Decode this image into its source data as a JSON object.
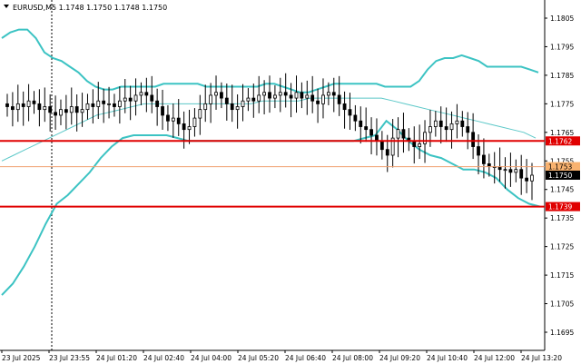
{
  "symbol_header": {
    "menu_icon": "triangle-down-icon",
    "text": "EURUSD,M5  1.1748 1.1750 1.1748 1.1750"
  },
  "chart_data": {
    "type": "candlestick",
    "symbol": "EURUSD,M5",
    "ohlc_last": {
      "open": 1.1748,
      "high": 1.175,
      "low": 1.1748,
      "close": 1.175
    },
    "ylim": [
      1.169,
      1.1805
    ],
    "yticks": [
      "1.1805",
      "1.1795",
      "1.1785",
      "1.1775",
      "1.1765",
      "1.1755",
      "1.1745",
      "1.1735",
      "1.1725",
      "1.1715",
      "1.1705",
      "1.1695"
    ],
    "xticks": [
      "23 Jul 2025",
      "23 Jul 23:55",
      "24 Jul 01:20",
      "24 Jul 02:40",
      "24 Jul 04:00",
      "24 Jul 05:20",
      "24 Jul 06:40",
      "24 Jul 08:00",
      "24 Jul 09:20",
      "24 Jul 10:40",
      "24 Jul 12:00",
      "24 Jul 13:20"
    ],
    "horizontal_levels": [
      {
        "price": 1.1762,
        "label": "1.1762",
        "color": "#e00000"
      },
      {
        "price": 1.1739,
        "label": "1.1739",
        "color": "#e00000"
      }
    ],
    "current_price_tags": [
      {
        "price": 1.1753,
        "label": "1.1753",
        "style": "orange"
      },
      {
        "price": 1.175,
        "label": "1.1750",
        "style": "black"
      }
    ],
    "ask_line_price": 1.1753,
    "closes": [
      1.1774,
      1.1773,
      1.1775,
      1.1774,
      1.1776,
      1.1775,
      1.1773,
      1.1774,
      1.1772,
      1.1771,
      1.1773,
      1.1772,
      1.1774,
      1.1772,
      1.1773,
      1.1775,
      1.1774,
      1.1776,
      1.1775,
      1.1775,
      1.1774,
      1.1776,
      1.1777,
      1.1776,
      1.1778,
      1.1779,
      1.1778,
      1.1776,
      1.1774,
      1.1771,
      1.1769,
      1.177,
      1.1768,
      1.1766,
      1.1767,
      1.177,
      1.1773,
      1.1775,
      1.1778,
      1.1779,
      1.1777,
      1.1775,
      1.1773,
      1.1774,
      1.1776,
      1.1777,
      1.1776,
      1.1778,
      1.1779,
      1.1777,
      1.1778,
      1.1779,
      1.1778,
      1.1777,
      1.1779,
      1.1777,
      1.1778,
      1.1776,
      1.1775,
      1.1778,
      1.1779,
      1.1778,
      1.1775,
      1.1773,
      1.1771,
      1.1769,
      1.1767,
      1.1766,
      1.1764,
      1.1762,
      1.1759,
      1.1757,
      1.1763,
      1.1766,
      1.1763,
      1.1762,
      1.176,
      1.1761,
      1.1765,
      1.1767,
      1.1769,
      1.1767,
      1.1766,
      1.1768,
      1.1769,
      1.1767,
      1.1765,
      1.176,
      1.1757,
      1.1754,
      1.1753,
      1.1753,
      1.1752,
      1.1752,
      1.1751,
      1.1752,
      1.1749,
      1.1748,
      1.175
    ],
    "bollinger": {
      "upper": [
        1.1798,
        1.18,
        1.1801,
        1.1801,
        1.1798,
        1.1793,
        1.1791,
        1.179,
        1.1788,
        1.1786,
        1.1783,
        1.1781,
        1.178,
        1.178,
        1.1781,
        1.1781,
        1.1781,
        1.1781,
        1.1781,
        1.1782,
        1.1782,
        1.1782,
        1.1782,
        1.1782,
        1.1781,
        1.1781,
        1.1781,
        1.1781,
        1.1781,
        1.1781,
        1.1781,
        1.1782,
        1.1782,
        1.1781,
        1.178,
        1.1779,
        1.1779,
        1.178,
        1.1781,
        1.1782,
        1.1782,
        1.1782,
        1.1782,
        1.1782,
        1.1782,
        1.1781,
        1.1781,
        1.1781,
        1.1781,
        1.1783,
        1.1787,
        1.179,
        1.1791,
        1.1791,
        1.1792,
        1.1791,
        1.179,
        1.1788,
        1.1788,
        1.1788,
        1.1788,
        1.1788,
        1.1787,
        1.1786
      ],
      "middle": [
        1.1755,
        1.1757,
        1.1759,
        1.1761,
        1.1763,
        1.1765,
        1.1767,
        1.1769,
        1.1771,
        1.1772,
        1.1773,
        1.1774,
        1.1775,
        1.1775,
        1.1775,
        1.1775,
        1.1775,
        1.1775,
        1.1775,
        1.1775,
        1.1775,
        1.1775,
        1.1776,
        1.1776,
        1.1776,
        1.1776,
        1.1777,
        1.1777,
        1.1777,
        1.1777,
        1.1777,
        1.1777,
        1.1777,
        1.1776,
        1.1775,
        1.1774,
        1.1773,
        1.1772,
        1.1771,
        1.177,
        1.1769,
        1.1768,
        1.1767,
        1.1766,
        1.1765,
        1.1763
      ],
      "lower": [
        1.1708,
        1.1712,
        1.1718,
        1.1725,
        1.1733,
        1.174,
        1.1743,
        1.1747,
        1.1751,
        1.1756,
        1.176,
        1.1763,
        1.1764,
        1.1764,
        1.1764,
        1.1764,
        1.1763,
        1.1762,
        1.1762,
        1.1762,
        1.1762,
        1.1762,
        1.1762,
        1.1762,
        1.1762,
        1.1762,
        1.1762,
        1.1762,
        1.1762,
        1.1762,
        1.1762,
        1.1762,
        1.1762,
        1.1763,
        1.1764,
        1.1769,
        1.1766,
        1.1762,
        1.1759,
        1.1757,
        1.1756,
        1.1754,
        1.1752,
        1.1752,
        1.1751,
        1.1749,
        1.1745,
        1.1742,
        1.174,
        1.1739
      ]
    }
  },
  "colors": {
    "background": "#ffffff",
    "candle": "#000000",
    "bollinger_band": "#3cc3c3",
    "bollinger_middle": "#5cc8c8",
    "level_line": "#e00000",
    "ask_line": "#f0a070",
    "price_tag_orange": "#f9b26f",
    "price_tag_black": "#000000",
    "session_separator": "#000000"
  }
}
